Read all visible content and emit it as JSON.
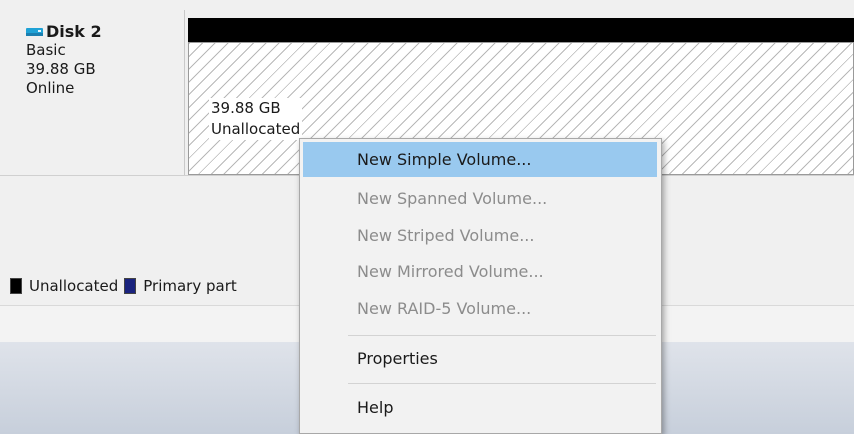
{
  "disk": {
    "name": "Disk 2",
    "type": "Basic",
    "size": "39.88 GB",
    "status": "Online"
  },
  "volume": {
    "size": "39.88 GB",
    "state": "Unallocated"
  },
  "legend": {
    "items": [
      {
        "label": "Unallocated",
        "color": "#000000"
      },
      {
        "label": "Primary part",
        "color": "#1a237e"
      }
    ]
  },
  "context_menu": {
    "items": [
      {
        "label": "New Simple Volume...",
        "enabled": true,
        "highlighted": true
      },
      {
        "label": "New Spanned Volume...",
        "enabled": false
      },
      {
        "label": "New Striped Volume...",
        "enabled": false
      },
      {
        "label": "New Mirrored Volume...",
        "enabled": false
      },
      {
        "label": "New RAID-5 Volume...",
        "enabled": false
      },
      {
        "label": "Properties",
        "enabled": true
      },
      {
        "label": "Help",
        "enabled": true
      }
    ]
  },
  "colors": {
    "highlight": "#99c9ef",
    "unallocated_bar": "#000000",
    "disabled_text": "#8c8c8c"
  }
}
